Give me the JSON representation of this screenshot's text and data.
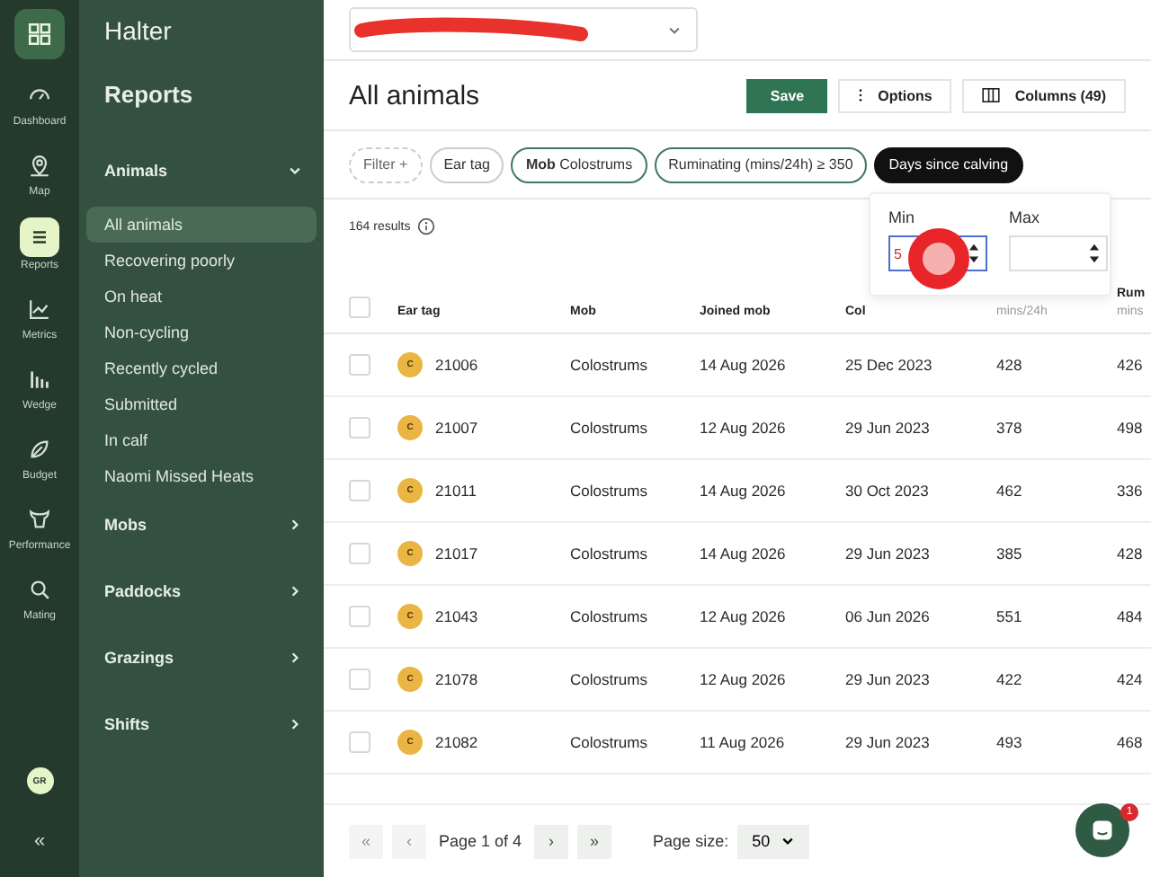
{
  "rail": {
    "items": [
      {
        "label": "Dashboard",
        "selected": false
      },
      {
        "label": "Map",
        "selected": false
      },
      {
        "label": "Reports",
        "selected": true
      },
      {
        "label": "Metrics",
        "selected": false
      },
      {
        "label": "Wedge",
        "selected": false
      },
      {
        "label": "Budget",
        "selected": false
      },
      {
        "label": "Performance",
        "selected": false
      },
      {
        "label": "Mating",
        "selected": false
      }
    ],
    "avatar": "GR",
    "collapse": "«"
  },
  "sidebar": {
    "brand": "Halter",
    "heading": "Reports",
    "sections": [
      {
        "title": "Animals",
        "expanded": true,
        "items": [
          {
            "label": "All animals",
            "selected": true
          },
          {
            "label": "Recovering poorly",
            "selected": false
          },
          {
            "label": "On heat",
            "selected": false
          },
          {
            "label": "Non-cycling",
            "selected": false
          },
          {
            "label": "Recently cycled",
            "selected": false
          },
          {
            "label": "Submitted",
            "selected": false
          },
          {
            "label": "In calf",
            "selected": false
          },
          {
            "label": "Naomi Missed Heats",
            "selected": false
          }
        ]
      },
      {
        "title": "Mobs",
        "expanded": false
      },
      {
        "title": "Paddocks",
        "expanded": false
      },
      {
        "title": "Grazings",
        "expanded": false
      },
      {
        "title": "Shifts",
        "expanded": false
      }
    ]
  },
  "farm_selector": {
    "redacted": true
  },
  "page_title": "All animals",
  "actions": [
    {
      "kind": "primary",
      "label": "Save"
    },
    {
      "kind": "options",
      "label": "Options"
    },
    {
      "kind": "columns",
      "label": "Columns (49)"
    }
  ],
  "filters": [
    {
      "kind": "add",
      "label": "Filter",
      "icon": "+"
    },
    {
      "kind": "plain",
      "label": "Ear tag"
    },
    {
      "kind": "applied",
      "label": "Mob",
      "value": "Colostrums"
    },
    {
      "kind": "applied",
      "label": "Ruminating (mins/24h) ≥ 350"
    },
    {
      "kind": "active",
      "label": "Days since calving"
    }
  ],
  "results": "164 results",
  "range_popover": {
    "min_label": "Min",
    "min_value": "5",
    "max_label": "Max"
  },
  "touch_indicator": true,
  "table": {
    "all_selected": false,
    "columns": [
      {
        "label": "Ear tag"
      },
      {
        "label": "Mob"
      },
      {
        "label": "Joined mob"
      },
      {
        "label": "Col"
      },
      {
        "sublabel": "mins/24h"
      },
      {
        "label": "Rum",
        "sublabel": "mins"
      }
    ],
    "rows": [
      {
        "selected": false,
        "badge": "C",
        "cells": [
          "21006",
          "Colostrums",
          "14 Aug 2026",
          "25 Dec 2023",
          "428",
          "426"
        ]
      },
      {
        "selected": false,
        "badge": "C",
        "cells": [
          "21007",
          "Colostrums",
          "12 Aug 2026",
          "29 Jun 2023",
          "378",
          "498"
        ]
      },
      {
        "selected": false,
        "badge": "C",
        "cells": [
          "21011",
          "Colostrums",
          "14 Aug 2026",
          "30 Oct 2023",
          "462",
          "336"
        ]
      },
      {
        "selected": false,
        "badge": "C",
        "cells": [
          "21017",
          "Colostrums",
          "14 Aug 2026",
          "29 Jun 2023",
          "385",
          "428"
        ]
      },
      {
        "selected": false,
        "badge": "C",
        "cells": [
          "21043",
          "Colostrums",
          "12 Aug 2026",
          "06 Jun 2026",
          "551",
          "484"
        ]
      },
      {
        "selected": false,
        "badge": "C",
        "cells": [
          "21078",
          "Colostrums",
          "12 Aug 2026",
          "29 Jun 2023",
          "422",
          "424"
        ]
      },
      {
        "selected": false,
        "badge": "C",
        "cells": [
          "21082",
          "Colostrums",
          "11 Aug 2026",
          "29 Jun 2023",
          "493",
          "468"
        ]
      }
    ]
  },
  "pagination": {
    "first": {
      "label": "«",
      "disabled": true
    },
    "prev": {
      "label": "‹",
      "disabled": true
    },
    "page": "Page 1 of 4",
    "next": {
      "label": "›",
      "disabled": false
    },
    "last": {
      "label": "»",
      "disabled": false
    },
    "size_label": "Page size:",
    "size": "50"
  },
  "chat": {
    "badge": "1"
  }
}
